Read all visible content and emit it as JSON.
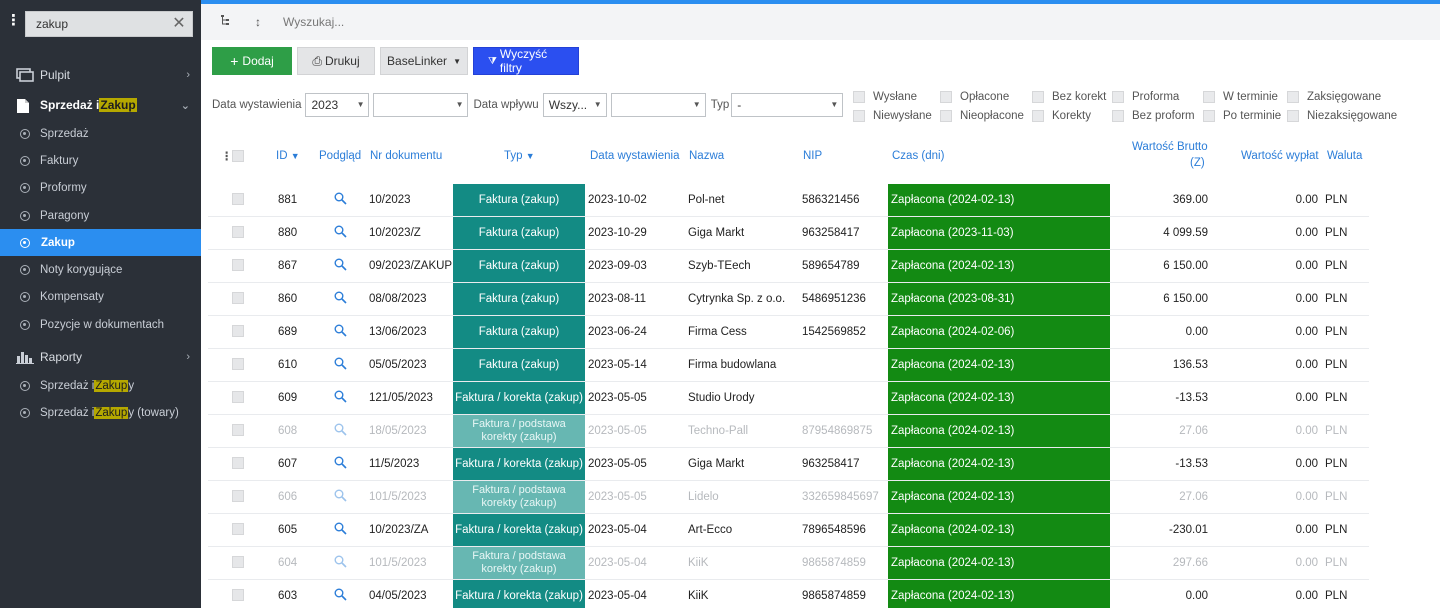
{
  "sidebar": {
    "search_value": "zakup",
    "sections": [
      {
        "label": "Pulpit",
        "icon": "desktop-icon",
        "expanded": false
      },
      {
        "label_pre": "Sprzedaż i ",
        "label_hl": "Zakup",
        "label_post": "",
        "icon": "document-icon",
        "expanded": true
      }
    ],
    "sub_items": [
      {
        "label": "Sprzedaż",
        "active": false
      },
      {
        "label": "Faktury",
        "active": false
      },
      {
        "label": "Proformy",
        "active": false
      },
      {
        "label": "Paragony",
        "active": false
      },
      {
        "label": "Zakup",
        "active": true
      },
      {
        "label": "Noty korygujące",
        "active": false
      },
      {
        "label": "Kompensaty",
        "active": false
      },
      {
        "label": "Pozycje w dokumentach",
        "active": false
      }
    ],
    "reports": {
      "label": "Raporty",
      "icon": "bar-chart-icon"
    },
    "report_items": [
      {
        "pre": "Sprzedaż i ",
        "hl": "Zakup",
        "post": "y"
      },
      {
        "pre": "Sprzedaż i ",
        "hl": "Zakup",
        "post": "y (towary)"
      }
    ]
  },
  "toolbar": {
    "search_placeholder": "Wyszukaj..."
  },
  "buttons": {
    "add": "Dodaj",
    "print": "Drukuj",
    "baselinker": "BaseLinker",
    "clear_filters": "Wyczyść filtry"
  },
  "filters": {
    "issue_date_label": "Data wystawienia",
    "issue_year": "2023",
    "issue_period": "",
    "receipt_date_label": "Data wpływu",
    "receipt_value": "Wszy...",
    "receipt_period": "",
    "type_label": "Typ",
    "type_value": "-",
    "checkboxes": [
      [
        "Wysłane",
        "Opłacone",
        "Bez korekt",
        "Proforma",
        "W terminie",
        "Zaksięgowane"
      ],
      [
        "Niewysłane",
        "Nieopłacone",
        "Korekty",
        "Bez proform",
        "Po terminie",
        "Niezaksięgowane"
      ]
    ]
  },
  "table": {
    "headers": {
      "id": "ID",
      "preview": "Podgląd",
      "doc_no": "Nr dokumentu",
      "type": "Typ",
      "issue_date": "Data wystawienia",
      "name": "Nazwa",
      "nip": "NIP",
      "time": "Czas (dni)",
      "gross_1": "Wartość Brutto",
      "gross_2": "(Z)",
      "payout": "Wartość wypłat",
      "currency": "Waluta"
    },
    "rows": [
      {
        "id": "881",
        "doc": "10/2023",
        "type": "Faktura (zakup)",
        "date": "2023-10-02",
        "name": "Pol-net",
        "nip": "586321456",
        "status": "Zapłacona (2024-02-13)",
        "gross": "369.00",
        "payout": "0.00",
        "cur": "PLN",
        "faded": false
      },
      {
        "id": "880",
        "doc": "10/2023/Z",
        "type": "Faktura (zakup)",
        "date": "2023-10-29",
        "name": "Giga Markt",
        "nip": "963258417",
        "status": "Zapłacona (2023-11-03)",
        "gross": "4 099.59",
        "payout": "0.00",
        "cur": "PLN",
        "faded": false
      },
      {
        "id": "867",
        "doc": "09/2023/ZAKUP",
        "type": "Faktura (zakup)",
        "date": "2023-09-03",
        "name": "Szyb-TEech",
        "nip": "589654789",
        "status": "Zapłacona (2024-02-13)",
        "gross": "6 150.00",
        "payout": "0.00",
        "cur": "PLN",
        "faded": false
      },
      {
        "id": "860",
        "doc": "08/08/2023",
        "type": "Faktura (zakup)",
        "date": "2023-08-11",
        "name": "Cytrynka Sp. z o.o.",
        "nip": "5486951236",
        "status": "Zapłacona (2023-08-31)",
        "gross": "6 150.00",
        "payout": "0.00",
        "cur": "PLN",
        "faded": false
      },
      {
        "id": "689",
        "doc": "13/06/2023",
        "type": "Faktura (zakup)",
        "date": "2023-06-24",
        "name": "Firma Cess",
        "nip": "1542569852",
        "status": "Zapłacona (2024-02-06)",
        "gross": "0.00",
        "payout": "0.00",
        "cur": "PLN",
        "faded": false
      },
      {
        "id": "610",
        "doc": "05/05/2023",
        "type": "Faktura (zakup)",
        "date": "2023-05-14",
        "name": "Firma budowlana",
        "nip": "",
        "status": "Zapłacona (2024-02-13)",
        "gross": "136.53",
        "payout": "0.00",
        "cur": "PLN",
        "faded": false
      },
      {
        "id": "609",
        "doc": "121/05/2023",
        "type": "Faktura / korekta (zakup)",
        "date": "2023-05-05",
        "name": "Studio Urody",
        "nip": "",
        "status": "Zapłacona (2024-02-13)",
        "gross": "-13.53",
        "payout": "0.00",
        "cur": "PLN",
        "faded": false
      },
      {
        "id": "608",
        "doc": "18/05/2023",
        "type": "Faktura / podstawa korekty (zakup)",
        "date": "2023-05-05",
        "name": "Techno-Pall",
        "nip": "87954869875",
        "status": "Zapłacona (2024-02-13)",
        "gross": "27.06",
        "payout": "0.00",
        "cur": "PLN",
        "faded": true
      },
      {
        "id": "607",
        "doc": "11/5/2023",
        "type": "Faktura / korekta (zakup)",
        "date": "2023-05-05",
        "name": "Giga Markt",
        "nip": "963258417",
        "status": "Zapłacona (2024-02-13)",
        "gross": "-13.53",
        "payout": "0.00",
        "cur": "PLN",
        "faded": false
      },
      {
        "id": "606",
        "doc": "101/5/2023",
        "type": "Faktura / podstawa korekty (zakup)",
        "date": "2023-05-05",
        "name": "Lidelo",
        "nip": "332659845697",
        "status": "Zapłacona (2024-02-13)",
        "gross": "27.06",
        "payout": "0.00",
        "cur": "PLN",
        "faded": true
      },
      {
        "id": "605",
        "doc": "10/2023/ZA",
        "type": "Faktura / korekta (zakup)",
        "date": "2023-05-04",
        "name": "Art-Ecco",
        "nip": "7896548596",
        "status": "Zapłacona (2024-02-13)",
        "gross": "-230.01",
        "payout": "0.00",
        "cur": "PLN",
        "faded": false
      },
      {
        "id": "604",
        "doc": "101/5/2023",
        "type": "Faktura / podstawa korekty (zakup)",
        "date": "2023-05-04",
        "name": "KiiK",
        "nip": "9865874859",
        "status": "Zapłacona (2024-02-13)",
        "gross": "297.66",
        "payout": "0.00",
        "cur": "PLN",
        "faded": true
      },
      {
        "id": "603",
        "doc": "04/05/2023",
        "type": "Faktura / korekta (zakup)",
        "date": "2023-05-04",
        "name": "KiiK",
        "nip": "9865874859",
        "status": "Zapłacona (2024-02-13)",
        "gross": "0.00",
        "payout": "0.00",
        "cur": "PLN",
        "faded": false
      }
    ]
  },
  "colors": {
    "sidebar_bg": "#2b3038",
    "accent_blue": "#2b8ef0",
    "type_teal": "#138b84",
    "status_green": "#138a13",
    "highlight": "#b5a800"
  }
}
